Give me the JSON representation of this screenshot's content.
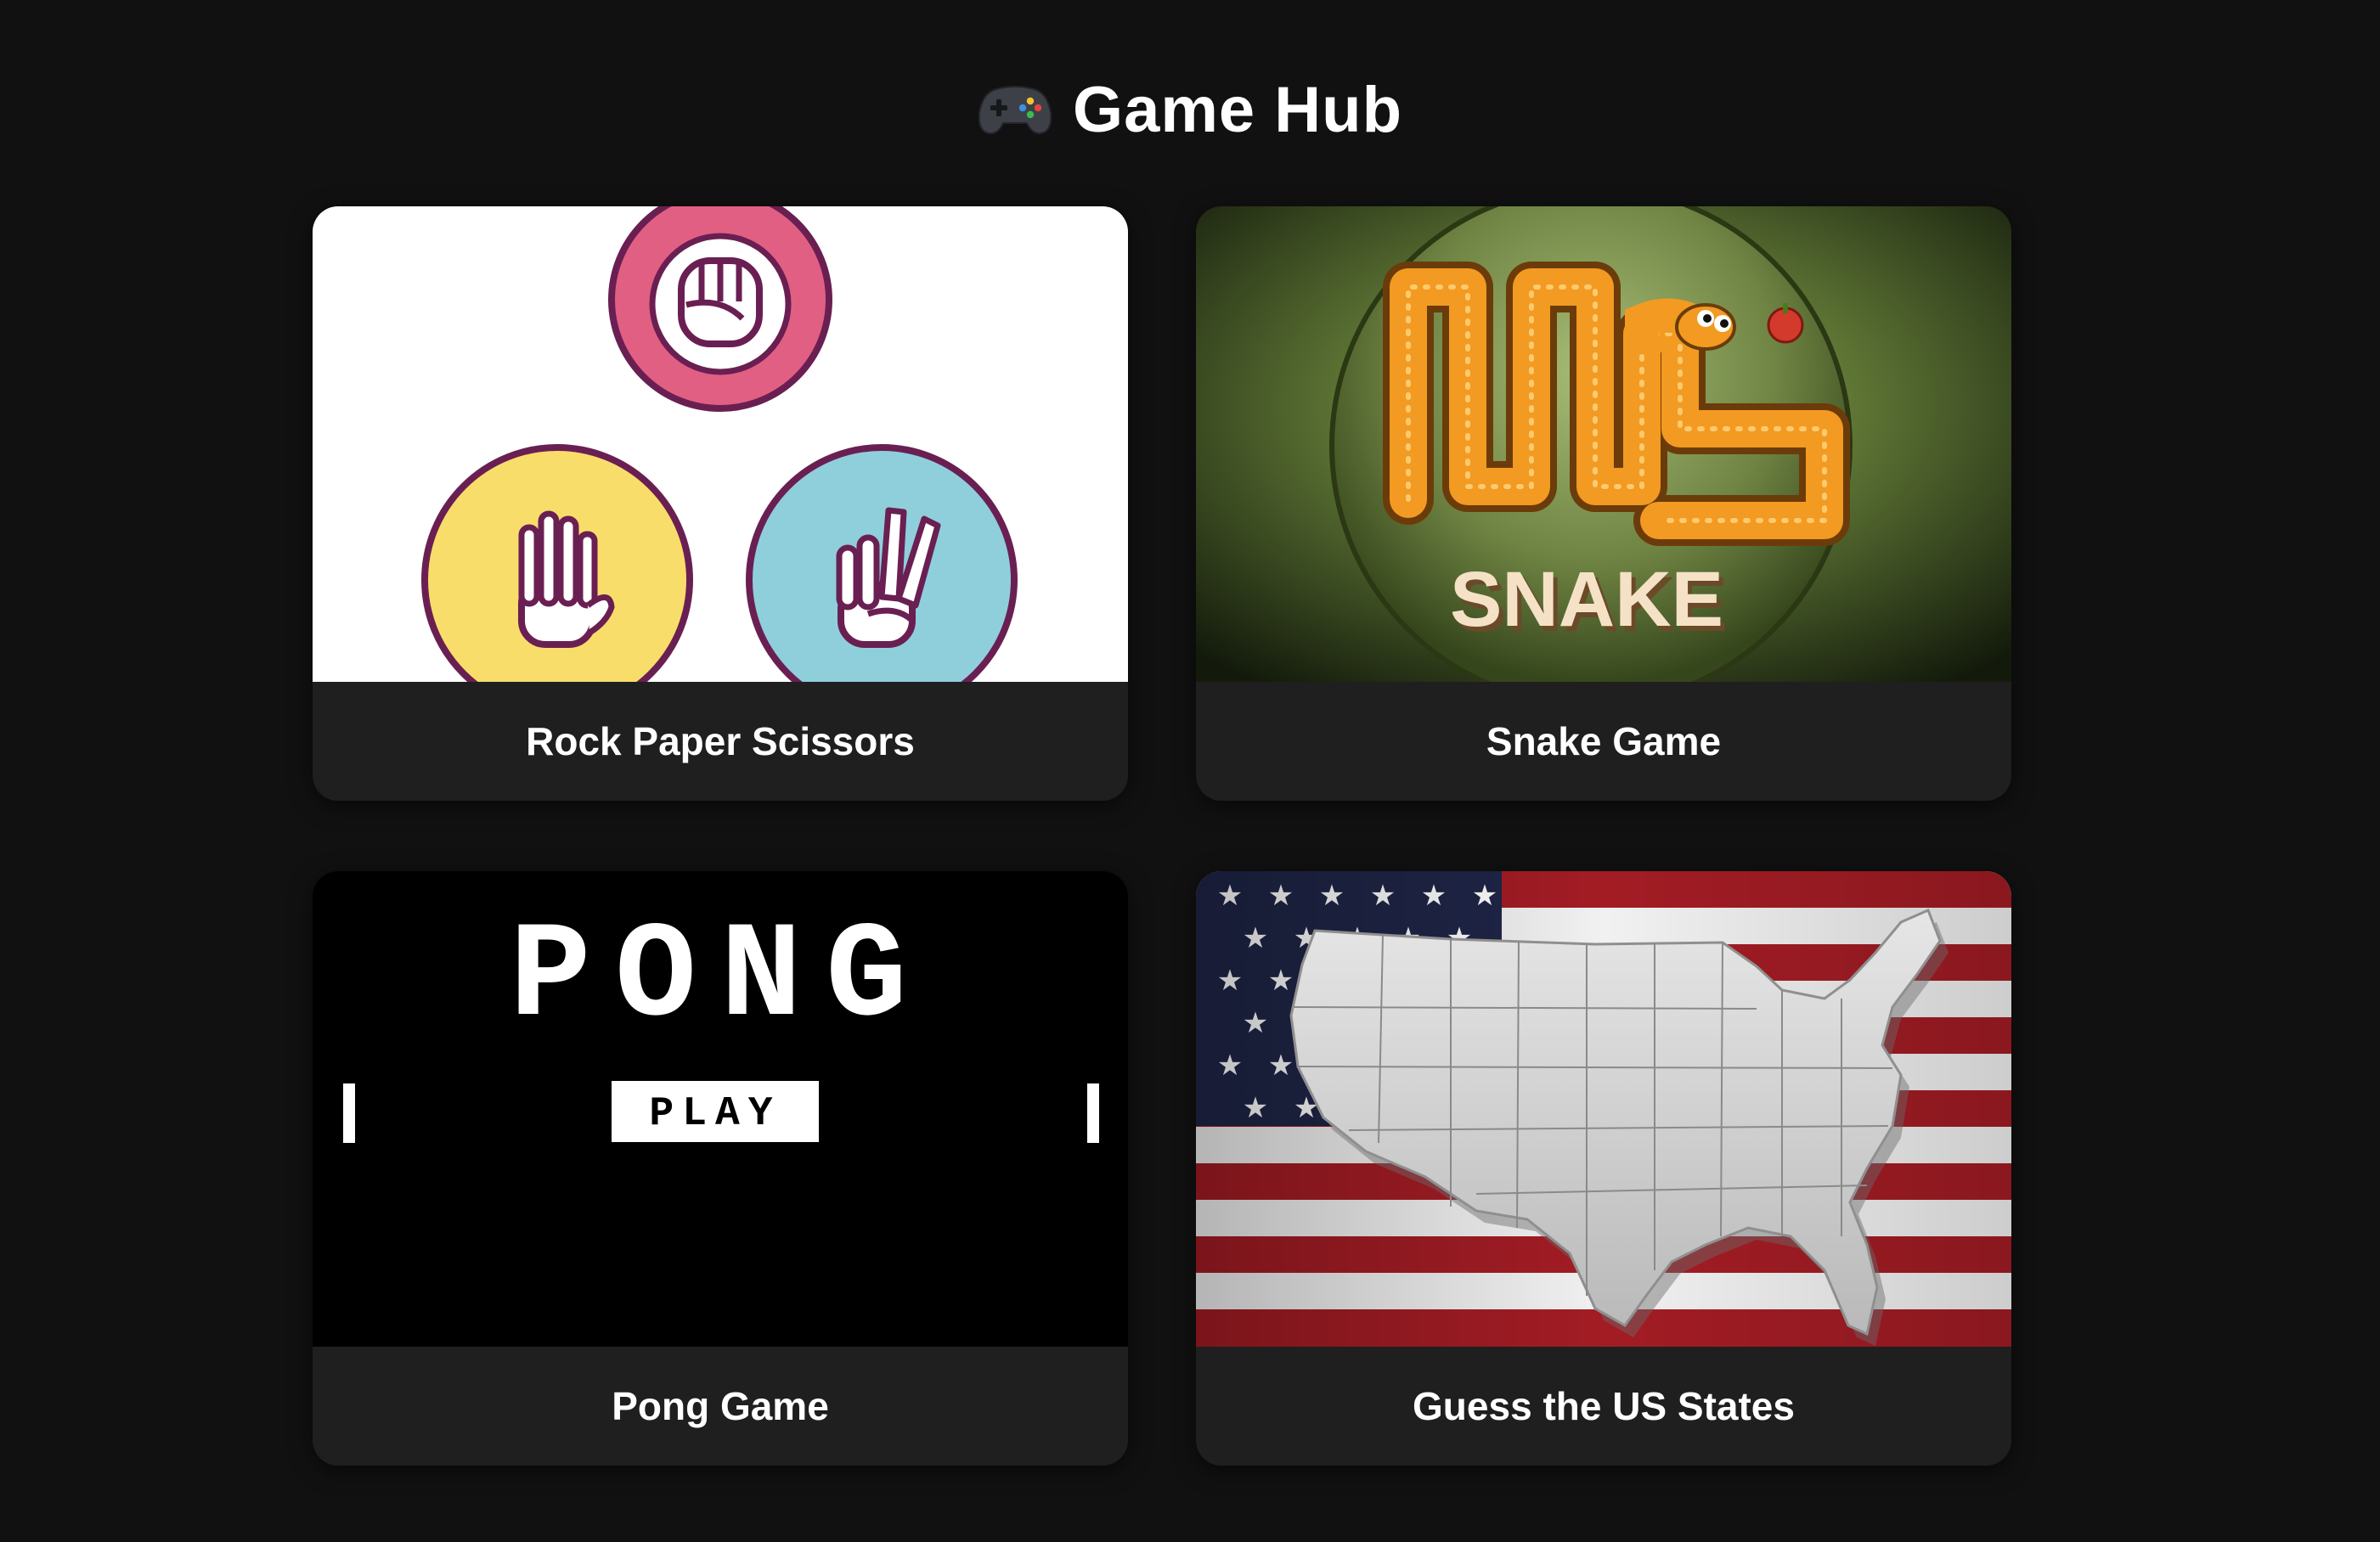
{
  "header": {
    "title": "Game Hub",
    "icon": "game-controller-icon"
  },
  "games": [
    {
      "label": "Rock Paper Scissors",
      "image": "rock-paper-scissors-hands",
      "colors": {
        "rock": "#e25f84",
        "paper": "#f9dd6b",
        "scissors": "#8fcfdb",
        "outline": "#6a1f52"
      }
    },
    {
      "label": "Snake Game",
      "image": "snake-logo",
      "logo_text": "SNAKE",
      "colors": {
        "snake": "#f29a22",
        "background": "#4a5e2c"
      }
    },
    {
      "label": "Pong Game",
      "image": "pong-title-screen",
      "logo_text": "PONG",
      "button_text": "PLAY",
      "colors": {
        "background": "#000000",
        "foreground": "#ffffff"
      }
    },
    {
      "label": "Guess the US States",
      "image": "us-map-over-flag",
      "colors": {
        "red": "#a31c24",
        "white": "#f1f1f1",
        "blue": "#1f2547",
        "map": "#cfcfcf"
      }
    }
  ]
}
